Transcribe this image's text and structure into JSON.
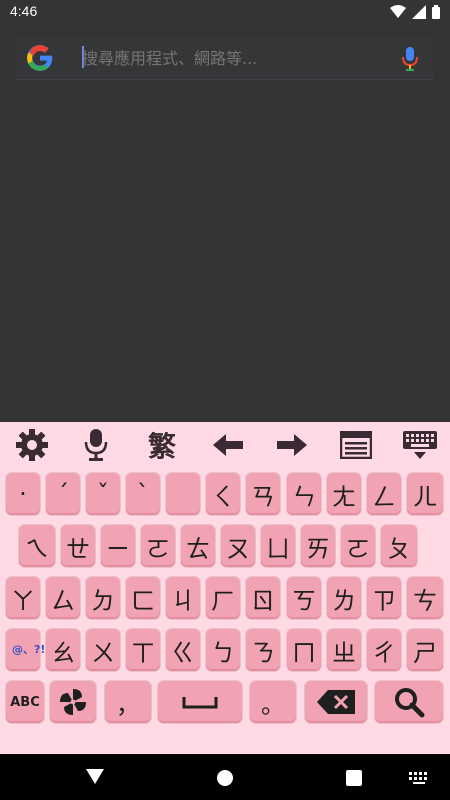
{
  "status_bar": {
    "time": "4:46"
  },
  "search": {
    "placeholder": "搜尋應用程式、網路等..."
  },
  "colors": {
    "keyboard_bg": "#ffd9e3",
    "key_bg": "#f2a3b3",
    "background": "#333436"
  },
  "keyboard": {
    "toolbar": {
      "traditional_label": "繁"
    },
    "row1": [
      "·",
      "ˊ",
      "ˇ",
      "ˋ",
      "˙",
      "ㄑ",
      "ㄢ",
      "ㄣ",
      "ㄤ",
      "ㄥ",
      "ㄦ"
    ],
    "row2": [
      "ㄟ",
      "ㄝ",
      "ㄧ",
      "ㄛ",
      "ㄊ",
      "ㄡ",
      "ㄩ",
      "ㄞ",
      "ㄛ",
      "ㄆ"
    ],
    "row3": [
      "ㄚ",
      "ㄙ",
      "ㄉ",
      "ㄈ",
      "ㄐ",
      "ㄏ",
      "ㄖ",
      "ㄎ",
      "ㄌ",
      "ㄗ",
      "ㄘ"
    ],
    "row4_symbol": "@、?!",
    "row4": [
      "ㄠ",
      "ㄨ",
      "ㄒ",
      "ㄍ",
      "ㄅ",
      "ㄋ",
      "ㄇ",
      "ㄓ",
      "ㄔ",
      "ㄕ"
    ],
    "row5": {
      "abc": "ABC",
      "comma": "，",
      "period": "。"
    }
  }
}
